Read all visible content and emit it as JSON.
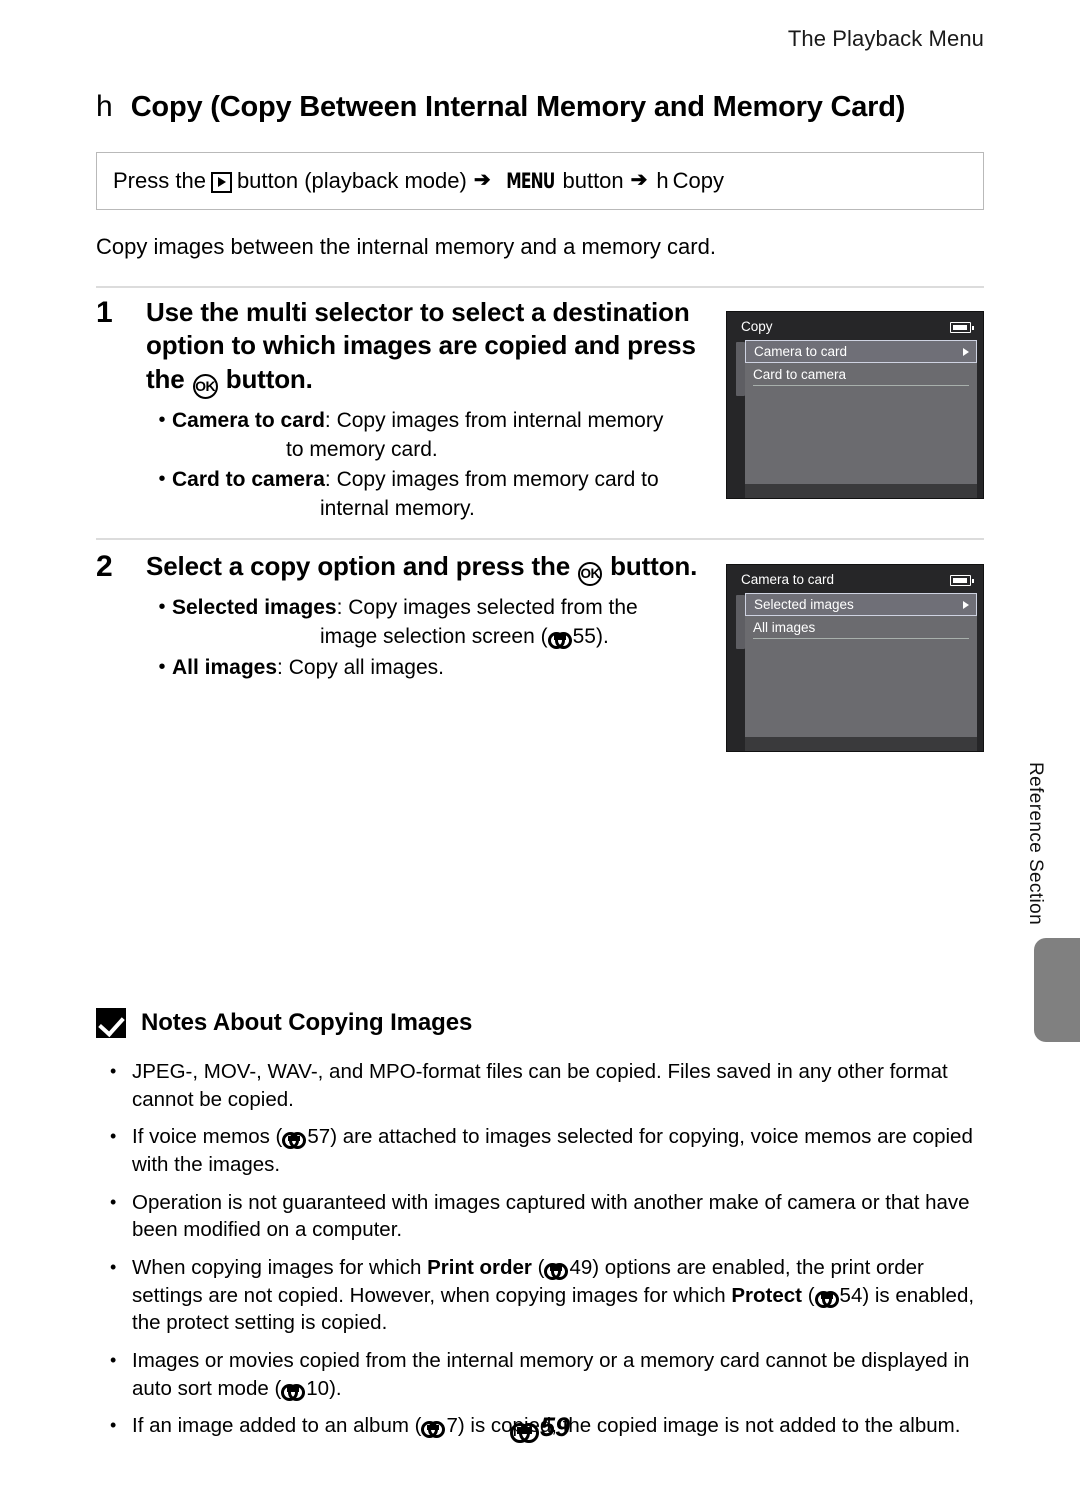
{
  "running_head": "The Playback Menu",
  "title": {
    "glyph": "h",
    "text": "Copy (Copy Between Internal Memory and Memory Card)"
  },
  "path_box": {
    "prefix": "Press the",
    "play_icon": "playback-icon",
    "after_play": "button (playback mode)",
    "arrow": "➔",
    "menu_label": "MENU",
    "after_menu": "button",
    "target_glyph": "h",
    "target_label": "Copy"
  },
  "intro": "Copy images between the internal memory and a memory card.",
  "steps": [
    {
      "number": "1",
      "title_before": "Use the multi selector to select a destination option to which images are copied and press the",
      "title_ok": "OK",
      "title_after": "button.",
      "options": [
        {
          "name": "Camera to card",
          "sep": ": ",
          "text": "Copy images from internal memory",
          "cont": "to memory card."
        },
        {
          "name": "Card to camera",
          "sep": ": ",
          "text": "Copy images from memory card to",
          "cont": "internal memory."
        }
      ]
    },
    {
      "number": "2",
      "title_before": "Select a copy option and press the",
      "title_ok": "OK",
      "title_after": "button.",
      "options": [
        {
          "name": "Selected images",
          "sep": ": ",
          "text": "Copy images selected from the",
          "cont_pre": "image selection screen (",
          "cont_ref": "55",
          "cont_post": ")."
        },
        {
          "name": "All images",
          "sep": ": ",
          "text": "Copy all images."
        }
      ]
    }
  ],
  "screens": [
    {
      "title": "Copy",
      "battery_icon": "battery-icon",
      "items": [
        {
          "label": "Camera to card",
          "selected": true
        },
        {
          "label": "Card to camera",
          "selected": false
        }
      ]
    },
    {
      "title": "Camera to card",
      "battery_icon": "battery-icon",
      "items": [
        {
          "label": "Selected images",
          "selected": true
        },
        {
          "label": "All images",
          "selected": false
        }
      ]
    }
  ],
  "reference_tab": "Reference Section",
  "notes": {
    "icon": "check-box-icon",
    "title": "Notes About Copying Images",
    "items": [
      {
        "parts": [
          {
            "t": "text",
            "v": "JPEG-, MOV-, WAV-, and MPO-format files can be copied. Files saved in any other format cannot be copied."
          }
        ]
      },
      {
        "parts": [
          {
            "t": "text",
            "v": "If voice memos ("
          },
          {
            "t": "ref",
            "v": "57"
          },
          {
            "t": "text",
            "v": ") are attached to images selected for copying, voice memos are copied with the images."
          }
        ]
      },
      {
        "parts": [
          {
            "t": "text",
            "v": "Operation is not guaranteed with images captured with another make of camera or that have been modified on a computer."
          }
        ]
      },
      {
        "parts": [
          {
            "t": "text",
            "v": "When copying images for which "
          },
          {
            "t": "bold",
            "v": "Print order"
          },
          {
            "t": "text",
            "v": " ("
          },
          {
            "t": "ref",
            "v": "49"
          },
          {
            "t": "text",
            "v": ") options are enabled, the print order settings are not copied. However, when copying images for which "
          },
          {
            "t": "bold",
            "v": "Protect"
          },
          {
            "t": "text",
            "v": " ("
          },
          {
            "t": "ref",
            "v": "54"
          },
          {
            "t": "text",
            "v": ") is enabled, the protect setting is copied."
          }
        ]
      },
      {
        "parts": [
          {
            "t": "text",
            "v": "Images or movies copied from the internal memory or a memory card cannot be displayed in auto sort mode ("
          },
          {
            "t": "ref",
            "v": "10"
          },
          {
            "t": "text",
            "v": ")."
          }
        ]
      },
      {
        "parts": [
          {
            "t": "text",
            "v": "If an image added to an album ("
          },
          {
            "t": "ref",
            "v": "7"
          },
          {
            "t": "text",
            "v": ") is copied, the copied image is not added to the album."
          }
        ]
      }
    ]
  },
  "folio": "59",
  "colors": {
    "screen_bg": "#262628",
    "screen_list": "#6b6b6f",
    "screen_selected": "#6f6f77",
    "screen_selected_border": "#cfd3e2",
    "divider": "#dcdcdc",
    "tab_gray": "#808080"
  }
}
